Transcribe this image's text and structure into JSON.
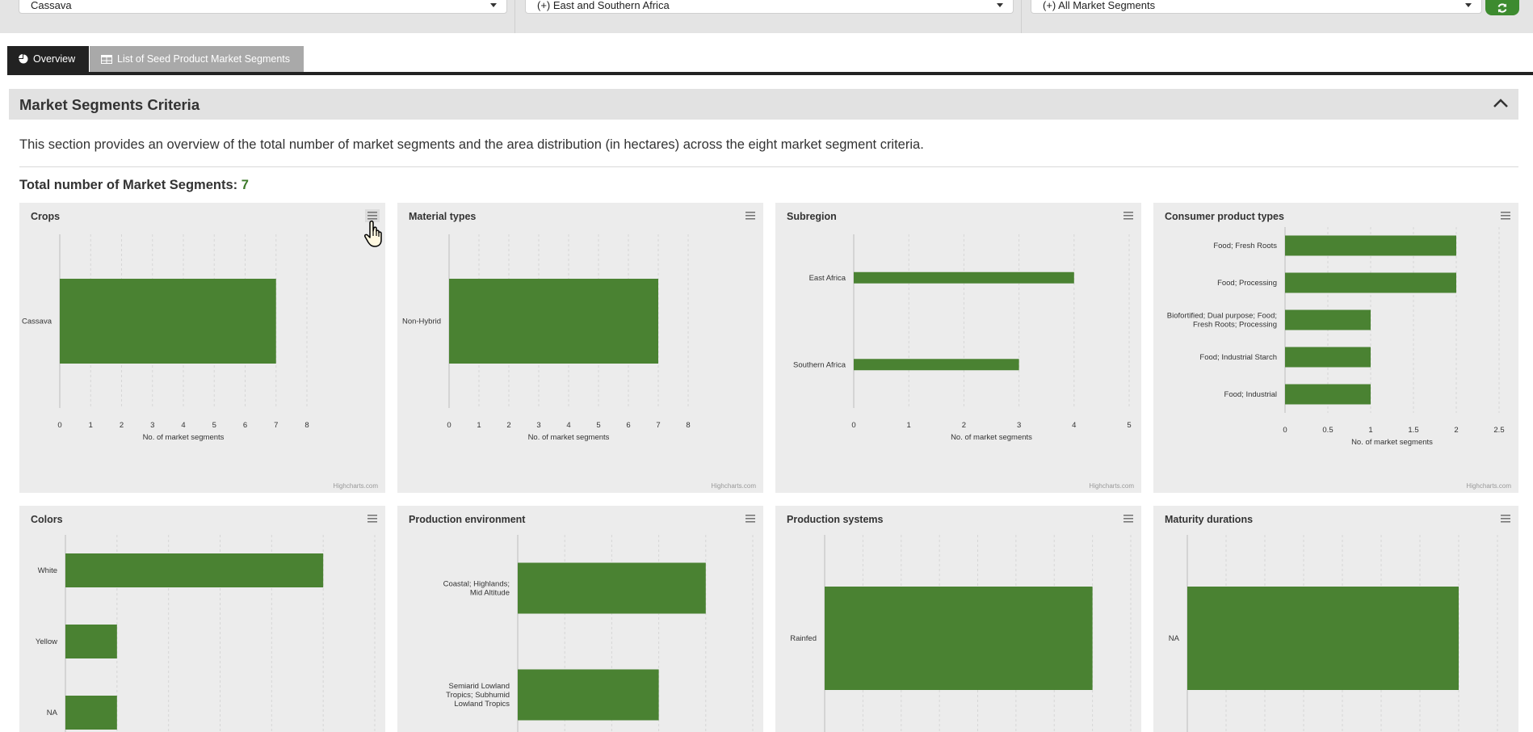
{
  "filters": {
    "crop": "Cassava",
    "region": "(+) East and Southern Africa",
    "segments": "(+) All Market Segments"
  },
  "tabs": [
    {
      "label": "Overview",
      "active": true
    },
    {
      "label": "List of Seed Product Market Segments",
      "active": false
    }
  ],
  "section": {
    "title": "Market Segments Criteria",
    "description": "This section provides an overview of the total number of market segments and the area distribution (in hectares) across the eight market segment criteria.",
    "total_label": "Total number of Market Segments:",
    "total_value": "7"
  },
  "colors": {
    "bar": "#4a8232",
    "accent": "#3d8b2f",
    "card": "#ececec"
  },
  "credit": "Highcharts.com",
  "chart_data": [
    {
      "type": "bar",
      "title": "Crops",
      "categories": [
        "Cassava"
      ],
      "values": [
        7
      ],
      "xlim": [
        0,
        8
      ],
      "ticks": [
        0,
        1,
        2,
        3,
        4,
        5,
        6,
        7,
        8
      ],
      "xlabel": "No. of market segments"
    },
    {
      "type": "bar",
      "title": "Material types",
      "categories": [
        "Non-Hybrid"
      ],
      "values": [
        7
      ],
      "xlim": [
        0,
        8
      ],
      "ticks": [
        0,
        1,
        2,
        3,
        4,
        5,
        6,
        7,
        8
      ],
      "xlabel": "No. of market segments"
    },
    {
      "type": "bar",
      "title": "Subregion",
      "categories": [
        "East Africa",
        "Southern Africa"
      ],
      "values": [
        4,
        3
      ],
      "xlim": [
        0,
        5
      ],
      "ticks": [
        0,
        1,
        2,
        3,
        4,
        5
      ],
      "xlabel": "No. of market segments"
    },
    {
      "type": "bar",
      "title": "Consumer product types",
      "categories": [
        "Food; Fresh Roots",
        "Food; Processing",
        "Biofortified; Dual purpose; Food; Fresh Roots; Processing",
        "Food; Industrial Starch",
        "Food; Industrial"
      ],
      "values": [
        2,
        2,
        1,
        1,
        1
      ],
      "xlim": [
        0,
        2.5
      ],
      "ticks": [
        0,
        0.5,
        1,
        1.5,
        2,
        2.5
      ],
      "xlabel": "No. of market segments"
    },
    {
      "type": "bar",
      "title": "Colors",
      "categories": [
        "White",
        "Yellow",
        "NA"
      ],
      "values": [
        5,
        1,
        1
      ],
      "xlim": [
        0,
        6
      ],
      "xlabel": ""
    },
    {
      "type": "bar",
      "title": "Production environment",
      "categories": [
        "Coastal; Highlands; Mid Altitude",
        "Semiarid Lowland Tropics; Subhumid Lowland Tropics"
      ],
      "values": [
        4,
        3
      ],
      "xlim": [
        0,
        5
      ],
      "xlabel": ""
    },
    {
      "type": "bar",
      "title": "Production systems",
      "categories": [
        "Rainfed"
      ],
      "values": [
        7
      ],
      "xlim": [
        0,
        8
      ],
      "xlabel": ""
    },
    {
      "type": "bar",
      "title": "Maturity durations",
      "categories": [
        "NA"
      ],
      "values": [
        7
      ],
      "xlim": [
        0,
        8
      ],
      "xlabel": ""
    }
  ]
}
